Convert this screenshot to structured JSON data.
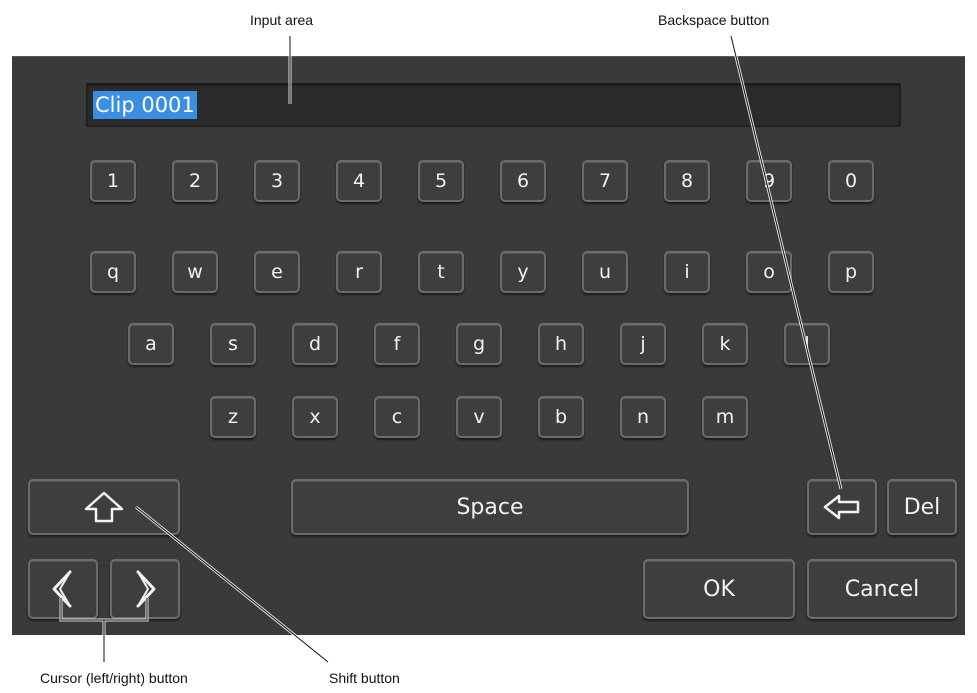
{
  "callouts": {
    "input_area": "Input area",
    "backspace_button": "Backspace button",
    "cursor_button": "Cursor (left/right) button",
    "shift_button": "Shift button"
  },
  "input": {
    "value": "Clip 0001"
  },
  "keys": {
    "digits": [
      "1",
      "2",
      "3",
      "4",
      "5",
      "6",
      "7",
      "8",
      "9",
      "0"
    ],
    "row_q": [
      "q",
      "w",
      "e",
      "r",
      "t",
      "y",
      "u",
      "i",
      "o",
      "p"
    ],
    "row_a": [
      "a",
      "s",
      "d",
      "f",
      "g",
      "h",
      "j",
      "k",
      "l"
    ],
    "row_z": [
      "z",
      "x",
      "c",
      "v",
      "b",
      "n",
      "m"
    ],
    "space": "Space",
    "del": "Del",
    "ok": "OK",
    "cancel": "Cancel"
  },
  "icons": {
    "shift": "shift-arrow-icon",
    "backspace": "backspace-arrow-icon",
    "cursor_left": "chevron-left-icon",
    "cursor_right": "chevron-right-icon"
  },
  "colors": {
    "panel": "#3a3a3a",
    "key_face": "#3e3e3e",
    "key_border": "#6c6c6c",
    "selection": "#3a8fe0"
  }
}
